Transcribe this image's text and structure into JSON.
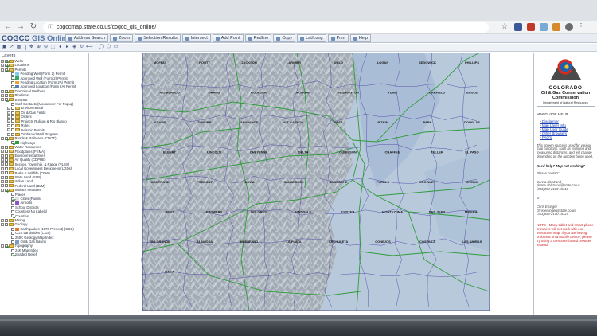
{
  "browser": {
    "url": "cogccmap.state.co.us/cogcc_gis_online/"
  },
  "app": {
    "title_prefix": "COGCC ",
    "title_suffix": "GIS Online"
  },
  "toolbar": [
    "Address Search",
    "Zoom",
    "Selection Results",
    "Intersect",
    "Add Point",
    "Redline",
    "Copy",
    "Lat/Long",
    "Print",
    "Help"
  ],
  "layers": {
    "title": "Layers",
    "items": [
      {
        "label": "Wells",
        "level": 0,
        "expander": "+",
        "checked": true,
        "kind": "folder"
      },
      {
        "label": "Locations",
        "level": 0,
        "expander": "+",
        "checked": true,
        "kind": "folder"
      },
      {
        "label": "Permits",
        "level": 0,
        "expander": "-",
        "checked": true,
        "kind": "folder"
      },
      {
        "label": "Pending Well (Form 2) Permit",
        "level": 1,
        "checked": false,
        "kind": "symbol",
        "color": "#7fd0e8"
      },
      {
        "label": "Approved Well (Form 2) Permit",
        "level": 1,
        "checked": true,
        "kind": "symbol",
        "color": "#39a86a"
      },
      {
        "label": "Pending Location (Form 2A) Permit",
        "level": 1,
        "checked": false,
        "kind": "symbol",
        "color": "#f0a030"
      },
      {
        "label": "Approved Location (Form 2A) Permit",
        "level": 1,
        "checked": true,
        "kind": "symbol",
        "color": "#5a7ac0"
      },
      {
        "label": "Directional Wellbore",
        "level": 0,
        "expander": "+",
        "checked": true,
        "kind": "folder"
      },
      {
        "label": "Pipelines",
        "level": 0,
        "expander": "+",
        "checked": false,
        "kind": "folder"
      },
      {
        "label": "COGCC",
        "level": 0,
        "expander": "-",
        "checked": true,
        "kind": "folder"
      },
      {
        "label": "Staff Contacts (Mouseover For Popup)",
        "level": 1,
        "checked": false,
        "kind": "plain"
      },
      {
        "label": "Environmental",
        "level": 1,
        "expander": "+",
        "checked": false,
        "kind": "folder"
      },
      {
        "label": "Oil & Gas Fields",
        "level": 1,
        "expander": "+",
        "checked": false,
        "kind": "folder"
      },
      {
        "label": "Orders",
        "level": 1,
        "expander": "+",
        "checked": false,
        "kind": "folder"
      },
      {
        "label": "Projects Rulison & Rio Blanco",
        "level": 1,
        "expander": "+",
        "checked": false,
        "kind": "folder"
      },
      {
        "label": "Rules",
        "level": 1,
        "expander": "+",
        "checked": false,
        "kind": "folder"
      },
      {
        "label": "Seismic Permits",
        "level": 1,
        "expander": "+",
        "checked": false,
        "kind": "folder"
      },
      {
        "label": "Orphaned Well Program",
        "level": 1,
        "expander": "+",
        "checked": false,
        "kind": "folder"
      },
      {
        "label": "Roads & Railroads (CDOT)",
        "level": 0,
        "expander": "-",
        "checked": true,
        "kind": "folder"
      },
      {
        "label": "Highways",
        "level": 1,
        "checked": true,
        "kind": "symbol",
        "color": "#2f9c3a"
      },
      {
        "label": "Water Resources",
        "level": 0,
        "expander": "+",
        "checked": false,
        "kind": "folder"
      },
      {
        "label": "Floodplains (FEMA)",
        "level": 0,
        "expander": "+",
        "checked": false,
        "kind": "folder"
      },
      {
        "label": "Environmental Sites",
        "level": 0,
        "expander": "+",
        "checked": false,
        "kind": "folder"
      },
      {
        "label": "Air Quality (CDPHE)",
        "level": 0,
        "expander": "+",
        "checked": false,
        "kind": "folder"
      },
      {
        "label": "Section, Township, & Range (PLSS)",
        "level": 0,
        "expander": "+",
        "checked": false,
        "kind": "folder"
      },
      {
        "label": "Local Government Designees (LGDs)",
        "level": 0,
        "expander": "+",
        "checked": false,
        "kind": "folder"
      },
      {
        "label": "Parks & Wildlife (CPW)",
        "level": 0,
        "expander": "+",
        "checked": false,
        "kind": "folder"
      },
      {
        "label": "State Land (SLB)",
        "level": 0,
        "expander": "+",
        "checked": false,
        "kind": "folder"
      },
      {
        "label": "Indian Land",
        "level": 0,
        "expander": "+",
        "checked": false,
        "kind": "folder"
      },
      {
        "label": "Federal Land (BLM)",
        "level": 0,
        "expander": "+",
        "checked": false,
        "kind": "folder"
      },
      {
        "label": "Surface Features",
        "level": 0,
        "expander": "-",
        "checked": true,
        "kind": "folder"
      },
      {
        "label": "Places",
        "level": 1,
        "checked": false,
        "kind": "plain"
      },
      {
        "label": "Cities (Points)",
        "level": 1,
        "checked": true,
        "kind": "symbol",
        "color": "#e0e0e0"
      },
      {
        "label": "Airports",
        "level": 1,
        "checked": false,
        "kind": "symbol",
        "color": "#8a4fc9"
      },
      {
        "label": "School Districts",
        "level": 1,
        "checked": false,
        "kind": "plain"
      },
      {
        "label": "Counties (No Labels)",
        "level": 1,
        "checked": false,
        "kind": "plain"
      },
      {
        "label": "Counties",
        "level": 1,
        "checked": true,
        "kind": "plain"
      },
      {
        "label": "Mining",
        "level": 0,
        "expander": "+",
        "checked": false,
        "kind": "folder"
      },
      {
        "label": "Geology",
        "level": 0,
        "expander": "-",
        "checked": false,
        "kind": "folder"
      },
      {
        "label": "Earthquakes (1973-Present) (CGS)",
        "level": 1,
        "checked": false,
        "kind": "symbol",
        "color": "#e07a3a"
      },
      {
        "label": "CGS Landslides (CGS)",
        "level": 1,
        "checked": false,
        "kind": "plain"
      },
      {
        "label": "250K Geology Map Index",
        "level": 1,
        "checked": false,
        "kind": "plain"
      },
      {
        "label": "Oil & Gas Basins",
        "level": 1,
        "checked": false,
        "kind": "symbol",
        "color": "#7a9cc8"
      },
      {
        "label": "Topography",
        "level": 0,
        "expander": "-",
        "checked": true,
        "kind": "folder"
      },
      {
        "label": "24K Map Index",
        "level": 1,
        "checked": false,
        "kind": "plain"
      },
      {
        "label": "Shaded Relief",
        "level": 1,
        "checked": true,
        "kind": "plain"
      }
    ]
  },
  "map": {
    "labels": [
      "MOFFAT",
      "ROUTT",
      "JACKSON",
      "LARIMER",
      "WELD",
      "LOGAN",
      "SEDGWICK",
      "PHILLIPS",
      "RIO BLANCO",
      "GRAND",
      "BOULDER",
      "MORGAN",
      "WASHINGTON",
      "YUMA",
      "GARFIELD",
      "EAGLE",
      "ADAMS",
      "DENVER",
      "ARAPAHOE",
      "KIT CARSON",
      "MESA",
      "PITKIN",
      "PARK",
      "DOUGLAS",
      "ELBERT",
      "LINCOLN",
      "CHEYENNE",
      "DELTA",
      "GUNNISON",
      "CHAFFEE",
      "TELLER",
      "EL PASO",
      "MONTROSE",
      "FREMONT",
      "KIOWA",
      "SAN MIGUEL",
      "SAGUACHE",
      "PUEBLO",
      "CROWLEY",
      "OTERO",
      "BENT",
      "PROWERS",
      "DOLORES",
      "HINSDALE",
      "CUSTER",
      "MONTEZUMA",
      "SAN JUAN",
      "MINERAL",
      "RIO GRANDE",
      "ALAMOSA",
      "HUERFANO",
      "LA PLATA",
      "ARCHULETA",
      "CONEJOS",
      "COSTILLA",
      "LAS ANIMAS",
      "BACA"
    ]
  },
  "help": {
    "org_line1": "COLORADO",
    "org_line2": "Oil & Gas Conservation",
    "org_line3": "Commission",
    "org_line4": "Department of Natural Resources",
    "title": "MAPGUIDE HELP",
    "links": [
      "Disclaimer",
      "Map Layer Info",
      "Map User Guide",
      "Other Browsers",
      "FAQ's"
    ],
    "description": "This screen space is used for various map functions, such as redlining and measuring distances, and will change depending on the function being used.",
    "question": "Need help? Map not working?",
    "please_contact": "Please contact:",
    "contact1": {
      "name": "Denna Ahlstrand",
      "email": "denna.ahlstrand@state.co.us",
      "phone": "(303)894-2100 x5116"
    },
    "or": "or",
    "contact2": {
      "name": "Chris Eisinger",
      "email": "chris.eisinger@state.co.us",
      "phone": "(303)894-2100 x5125"
    },
    "note": "NOTE - Many tablet and smart-phone browsers will not work with our interactive map. If you are having problems on a mobile device, please try using a computer-based browser instead."
  }
}
